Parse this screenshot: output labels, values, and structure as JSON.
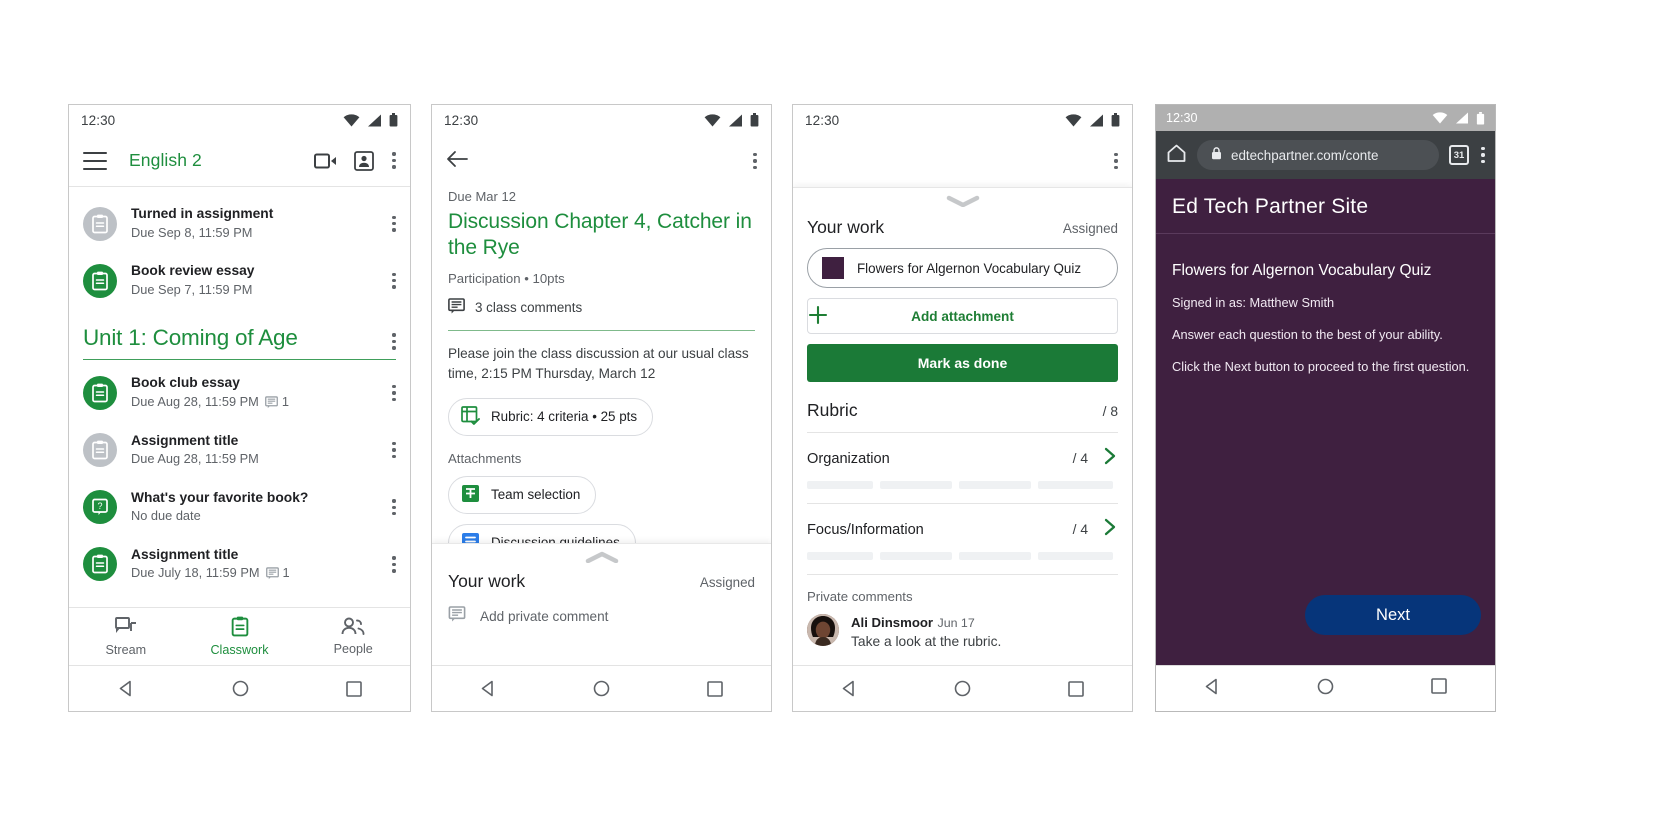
{
  "screens": {
    "classwork": {
      "status": {
        "time": "12:30"
      },
      "appbar": {
        "title": "English 2",
        "meet_icon": "video-camera-icon",
        "roster_icon": "roster-icon",
        "overflow_icon": "more-vert-icon",
        "menu_icon": "hamburger-menu-icon"
      },
      "top_items": [
        {
          "title": "Turned in assignment",
          "sub": "Due Sep 8, 11:59 PM",
          "icon": "assignment-icon",
          "icon_color": "grey",
          "comments": ""
        },
        {
          "title": "Book review essay",
          "sub": "Due Sep 7, 11:59 PM",
          "icon": "assignment-icon",
          "icon_color": "green",
          "comments": ""
        }
      ],
      "unit": {
        "title": "Unit 1: Coming of Age",
        "overflow_icon": "more-vert-icon"
      },
      "unit_items": [
        {
          "title": "Book club essay",
          "sub": "Due Aug 28, 11:59 PM",
          "icon": "assignment-icon",
          "icon_color": "green",
          "comments": "1"
        },
        {
          "title": "Assignment title",
          "sub": "Due Aug 28, 11:59 PM",
          "icon": "assignment-icon",
          "icon_color": "grey",
          "comments": ""
        },
        {
          "title": "What's your favorite book?",
          "sub": "No due date",
          "icon": "question-icon",
          "icon_color": "green",
          "comments": ""
        },
        {
          "title": "Assignment title",
          "sub": "Due July 18, 11:59 PM",
          "icon": "assignment-icon",
          "icon_color": "green",
          "comments": "1"
        }
      ],
      "bottom_nav": [
        {
          "label": "Stream",
          "icon": "stream-icon",
          "active": false
        },
        {
          "label": "Classwork",
          "icon": "classwork-icon",
          "active": true
        },
        {
          "label": "People",
          "icon": "people-icon",
          "active": false
        }
      ]
    },
    "assignment_detail": {
      "status": {
        "time": "12:30"
      },
      "back_icon": "back-arrow-icon",
      "overflow_icon": "more-vert-icon",
      "due": "Due Mar 12",
      "title": "Discussion Chapter 4, Catcher in the Rye",
      "meta": "Participation • 10pts",
      "class_comments": "3 class comments",
      "comments_icon": "comment-icon",
      "description": "Please join the class discussion at our usual class time, 2:15 PM Thursday, March 12",
      "rubric_chip": {
        "label": "Rubric: 4 criteria • 25 pts",
        "icon": "rubric-icon"
      },
      "attachments_label": "Attachments",
      "attachments": [
        {
          "label": "Team selection",
          "icon": "sheets-icon"
        },
        {
          "label": "Discussion guidelines",
          "icon": "docs-icon"
        }
      ],
      "sheet": {
        "title": "Your work",
        "status": "Assigned",
        "private_comment": "Add private comment",
        "comment_icon": "comment-icon",
        "grabber_icon": "chevron-up-icon"
      }
    },
    "your_work": {
      "status": {
        "time": "12:30"
      },
      "overflow_icon": "more-vert-icon",
      "grabber_icon": "chevron-down-icon",
      "header": {
        "title": "Your work",
        "status": "Assigned"
      },
      "attachment": {
        "label": "Flowers for Algernon Vocabulary Quiz",
        "thumb_color": "#3f2040"
      },
      "add_attachment": {
        "label": "Add attachment",
        "icon": "plus-icon"
      },
      "mark_done": "Mark as done",
      "rubric": {
        "title": "Rubric",
        "total": "/ 8"
      },
      "criteria": [
        {
          "name": "Organization",
          "points": "/ 4",
          "chevron_icon": "chevron-right-icon",
          "bars": [
            68,
            110,
            140,
            150
          ]
        },
        {
          "name": "Focus/Information",
          "points": "/ 4",
          "chevron_icon": "chevron-right-icon",
          "bars": [
            68,
            110,
            140,
            150
          ]
        }
      ],
      "private_comments": {
        "label": "Private comments",
        "author": "Ali Dinsmoor",
        "date": "Jun 17",
        "text": "Take a look at the rubric."
      }
    },
    "browser": {
      "status": {
        "time": "12:30"
      },
      "toolbar": {
        "home_icon": "home-icon",
        "lock_icon": "lock-icon",
        "url": "edtechpartner.com/conte",
        "tab_count": "31",
        "overflow_icon": "more-vert-icon"
      },
      "site_title": "Ed Tech Partner Site",
      "quiz_title": "Flowers for Algernon Vocabulary Quiz",
      "lines": [
        "Signed in as: Matthew Smith",
        "Answer each question to the best of your ability.",
        "Click the Next button to proceed to the first question."
      ],
      "next_button": "Next",
      "colors": {
        "page_bg": "#3f2040",
        "button": "#06357a",
        "toolbar": "#3c4043",
        "status": "#b0b0b0"
      }
    }
  },
  "system_nav": {
    "back_icon": "triangle-back-icon",
    "home_icon": "circle-home-icon",
    "recents_icon": "square-recents-icon"
  },
  "theme": {
    "green": "#1e8e3e",
    "dark_green": "#1b7a37",
    "grey_text": "#5f6368",
    "text": "#202124"
  }
}
